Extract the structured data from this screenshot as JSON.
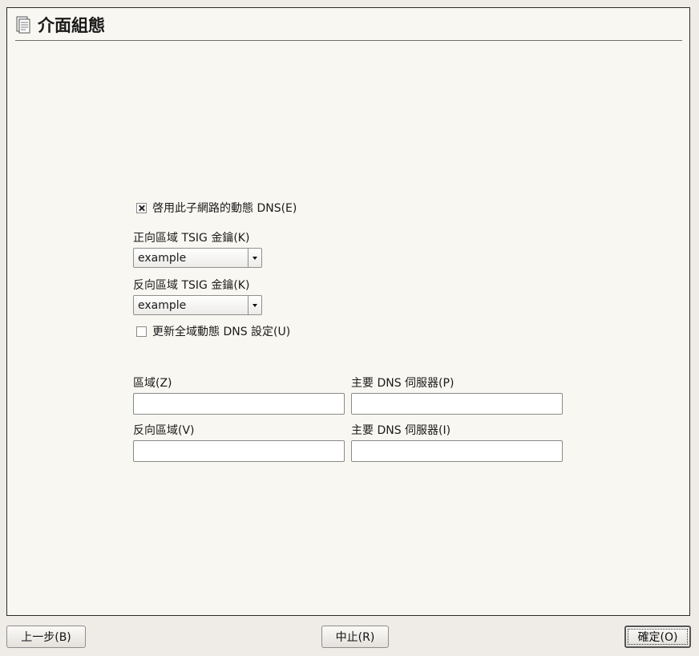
{
  "header": {
    "title": "介面組態",
    "icon": "document-list-icon"
  },
  "dynamic_dns": {
    "label": "啓用此子網路的動態 DNS(E)",
    "checked": true
  },
  "forward_tsig": {
    "label": "正向區域 TSIG 金鑰(K)",
    "value": "example"
  },
  "reverse_tsig": {
    "label": "反向區域 TSIG 金鑰(K)",
    "value": "example"
  },
  "global_ddns": {
    "label": "更新全域動態 DNS 設定(U)",
    "checked": false
  },
  "zone": {
    "label": "區域(Z)",
    "value": ""
  },
  "primary_dns_1": {
    "label": "主要 DNS 伺服器(P)",
    "value": ""
  },
  "reverse_zone": {
    "label": "反向區域(V)",
    "value": ""
  },
  "primary_dns_2": {
    "label": "主要 DNS 伺服器(I)",
    "value": ""
  },
  "buttons": {
    "back": "上一步(B)",
    "abort": "中止(R)",
    "ok": "確定(O)"
  }
}
